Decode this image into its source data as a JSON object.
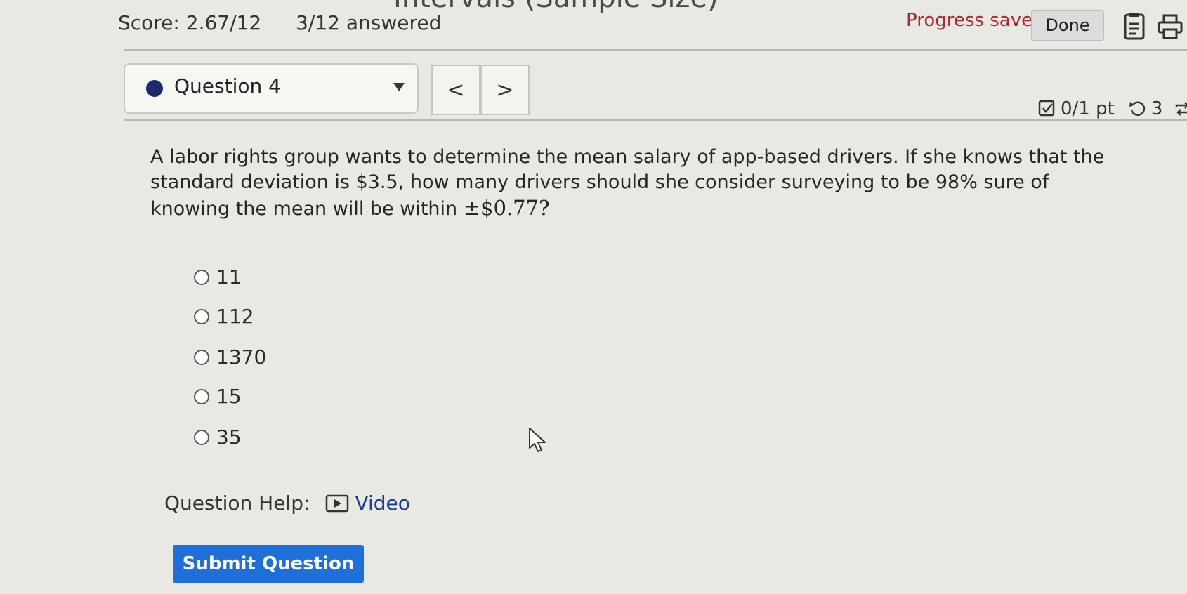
{
  "header": {
    "title_fragment": "Intervals (Sample Size)",
    "score": "Score: 2.67/12",
    "answered": "3/12 answered",
    "progress_status": "Progress saved",
    "done_label": "Done"
  },
  "question_nav": {
    "selected_question": "Question 4",
    "prev_label": "<",
    "next_label": ">",
    "points": "0/1 pt",
    "attempts": "3"
  },
  "question": {
    "text_before": "A labor rights group wants to determine the mean salary of app-based drivers. If she knows that the standard deviation is $3.5, how many drivers should she consider surveying to be 98% sure of knowing the mean will be within ",
    "margin_math": "±$0.77?"
  },
  "options": [
    {
      "label": "11"
    },
    {
      "label": "112"
    },
    {
      "label": "1370"
    },
    {
      "label": "15"
    },
    {
      "label": "35"
    }
  ],
  "help": {
    "label": "Question Help:",
    "video_label": "Video"
  },
  "submit_label": "Submit Question",
  "colors": {
    "accent_blue": "#1e6fd9",
    "progress_red": "#b0272f",
    "dot_navy": "#1f2a6e"
  }
}
